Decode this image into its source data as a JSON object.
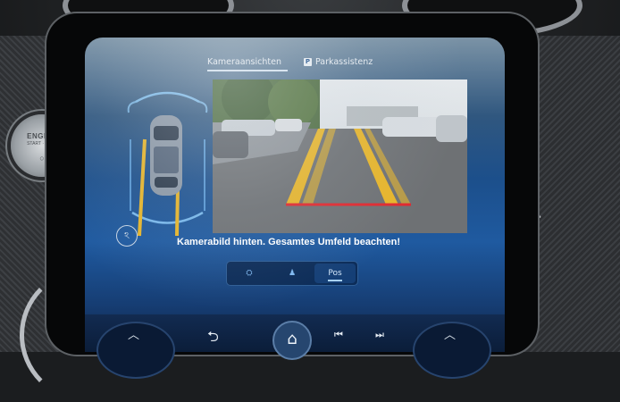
{
  "engine_button": {
    "label": "ENGINE",
    "sub_label": "START · STOP",
    "led": "○"
  },
  "tabs": {
    "camera_views": "Kameraansichten",
    "parking_assist_icon_glyph": "P",
    "parking_assist": "Parkassistenz"
  },
  "message": "Kamerabild hinten. Gesamtes Umfeld beachten!",
  "view_buttons": [
    {
      "icon": "top-view-car-icon",
      "glyph": "⛭"
    },
    {
      "icon": "person-icon",
      "glyph": "♟"
    },
    {
      "icon": "rear-view-icon",
      "glyph": "Pos"
    }
  ],
  "selected_view_index": 2,
  "nav": {
    "back_glyph": "⮌",
    "home_glyph": "⌂",
    "prev_glyph": "⏮",
    "next_glyph": "⏭",
    "knob_up_glyph": "︿"
  },
  "colors": {
    "screen_blue": "#1c4f8b",
    "guide_yellow": "#e7b52a",
    "stop_line_red": "#e0282e"
  }
}
